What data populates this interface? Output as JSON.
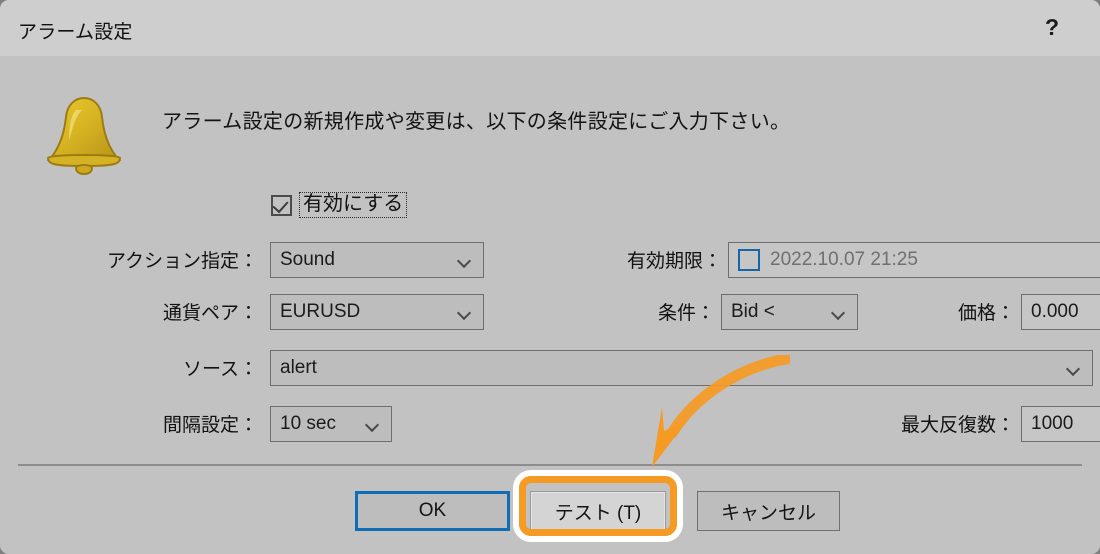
{
  "window": {
    "title": "アラーム設定",
    "help_label": "?",
    "titlebar_color": "#cecece",
    "body_color": "#c2c2c2"
  },
  "content": {
    "icon": "bell-icon",
    "intro_text": "アラーム設定の新規作成や変更は、以下の条件設定にご入力下さい。",
    "enable": {
      "label": "有効にする",
      "checked": true
    }
  },
  "fields": {
    "action": {
      "label": "アクション指定：",
      "value": "Sound",
      "type": "combobox"
    },
    "expiry": {
      "label": "有効期限：",
      "checkbox_checked": false,
      "value": "2022.10.07 21:25",
      "type": "datetime"
    },
    "symbol": {
      "label": "通貨ペア：",
      "value": "EURUSD",
      "type": "combobox"
    },
    "condition": {
      "label": "条件：",
      "value": "Bid <",
      "type": "combobox"
    },
    "price": {
      "label": "価格：",
      "value": "0.000",
      "type": "textbox"
    },
    "source": {
      "label": "ソース：",
      "value": "alert",
      "type": "combobox"
    },
    "timeout": {
      "label": "間隔設定：",
      "value": "10 sec",
      "type": "combobox"
    },
    "max_iterations": {
      "label": "最大反復数：",
      "value": "1000",
      "type": "textbox"
    }
  },
  "buttons": {
    "ok": "OK",
    "test": "テスト (T)",
    "cancel": "キャンセル"
  },
  "annotation": {
    "highlight_color": "#f59a23",
    "highlight_outline_color": "#ffffff",
    "arrow_color": "#f59a23",
    "target": "test-button"
  }
}
